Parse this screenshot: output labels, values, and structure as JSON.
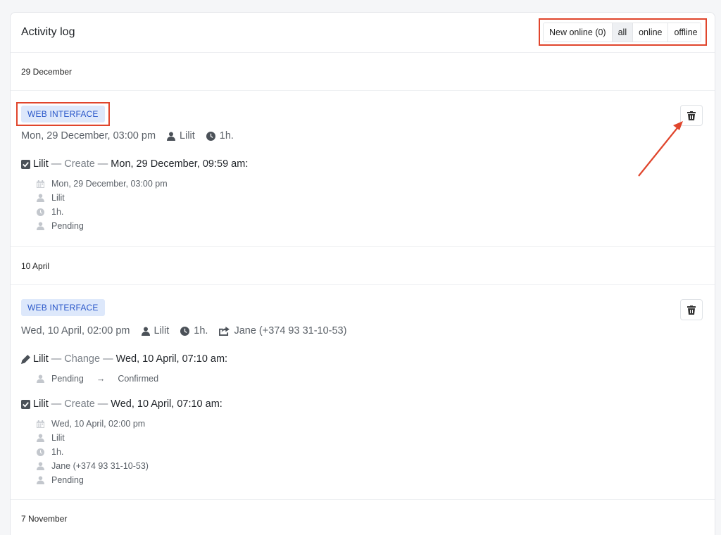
{
  "header": {
    "title": "Activity log",
    "filters": [
      {
        "label": "New online (0)",
        "active": false
      },
      {
        "label": "all",
        "active": true
      },
      {
        "label": "online",
        "active": false
      },
      {
        "label": "offline",
        "active": false
      }
    ]
  },
  "sections": [
    {
      "date": "29 December",
      "badge": "WEB INTERFACE",
      "summary": {
        "datetime": "Mon, 29 December, 03:00 pm",
        "user": "Lilit",
        "duration": "1h."
      },
      "entries": [
        {
          "icon": "check-square-icon",
          "user": "Lilit",
          "sep1": "—",
          "action": "Create",
          "sep2": "—",
          "timestamp": "Mon, 29 December, 09:59 am:",
          "details": [
            {
              "icon": "calendar-icon",
              "text": "Mon, 29 December, 03:00 pm"
            },
            {
              "icon": "user-icon",
              "text": "Lilit"
            },
            {
              "icon": "clock-icon",
              "text": "1h."
            },
            {
              "icon": "user-icon",
              "text": "Pending"
            }
          ]
        }
      ]
    },
    {
      "date": "10 April",
      "badge": "WEB INTERFACE",
      "summary": {
        "datetime": "Wed, 10 April, 02:00 pm",
        "user": "Lilit",
        "duration": "1h.",
        "client": "Jane (+374 93 31-10-53)"
      },
      "entries": [
        {
          "icon": "pencil-icon",
          "user": "Lilit",
          "sep1": "—",
          "action": "Change",
          "sep2": "—",
          "timestamp": "Wed, 10 April, 07:10 am:",
          "change": {
            "from": "Pending",
            "arrow": "→",
            "to": "Confirmed"
          }
        },
        {
          "icon": "check-square-icon",
          "user": "Lilit",
          "sep1": "—",
          "action": "Create",
          "sep2": "—",
          "timestamp": "Wed, 10 April, 07:10 am:",
          "details": [
            {
              "icon": "calendar-icon",
              "text": "Wed, 10 April, 02:00 pm"
            },
            {
              "icon": "user-icon",
              "text": "Lilit"
            },
            {
              "icon": "clock-icon",
              "text": "1h."
            },
            {
              "icon": "user-icon",
              "text": "Jane (+374 93 31-10-53)"
            },
            {
              "icon": "user-icon",
              "text": "Pending"
            }
          ]
        }
      ]
    }
  ],
  "next_date": "7 November",
  "colors": {
    "annotation": "#e0452c",
    "badge_bg": "#dde8fb",
    "badge_text": "#2a57c9"
  }
}
